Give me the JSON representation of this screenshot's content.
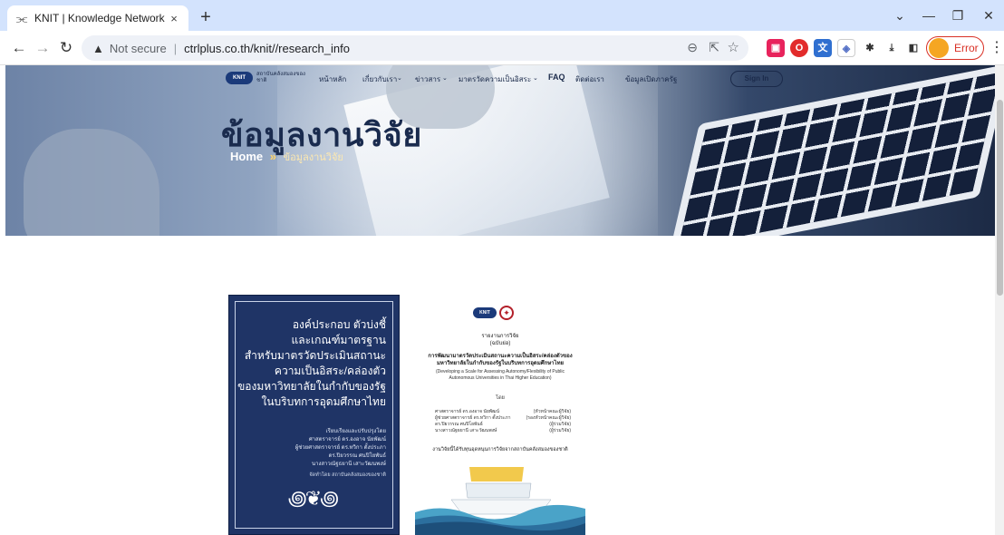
{
  "browser": {
    "tab_title": "KNIT | Knowledge Network Institu",
    "tab_close": "×",
    "new_tab": "+",
    "url_warning": "Not secure",
    "url": "ctrlplus.co.th/knit//research_info",
    "error_label": "Error",
    "minimize": "—",
    "restore": "❐",
    "close": "✕",
    "tabs_menu": "⌄"
  },
  "site": {
    "logo_badge": "KNIT",
    "logo_text": "สถาบันคลังสมองของชาติ",
    "nav": [
      {
        "label": "หน้าหลัก"
      },
      {
        "label": "เกี่ยวกับเรา"
      },
      {
        "label": "ข่าวสาร"
      },
      {
        "label": "มาตรวัดความเป็นอิสระ"
      },
      {
        "label": "FAQ"
      },
      {
        "label": "ติดต่อเรา"
      },
      {
        "label": "ข้อมูลเปิดภาครัฐ"
      }
    ],
    "signin": "Sign In",
    "hero_title": "ข้อมูลงานวิจัย",
    "breadcrumb_home": "Home",
    "breadcrumb_sep": "»",
    "breadcrumb_current": "ข้อมูลงานวิจัย"
  },
  "book": {
    "title_lines": [
      "องค์ประกอบ ตัวบ่งชี้",
      "และเกณฑ์มาตรฐาน",
      "สำหรับมาตรวัดประเมินสถานะ",
      "ความเป็นอิสระ/คล่องตัว",
      "ของมหาวิทยาลัยในกำกับของรัฐ",
      "ในบริบทการอุดมศึกษาไทย"
    ],
    "credits": [
      "เรียบเรียงและปรับปรุงโดย",
      "ศาสตราจารย์ ดร.องอาจ นัยพัฒน์",
      "ผู้ช่วยศาสตราจารย์ ดร.ทวิกา ตั้งประภา",
      "ดร.ปิยวรรณ ศนปิโยพันธ์",
      "นางสาวณัฐธยานี เสาะวัฒนพงษ์"
    ],
    "publisher": "จัดทำโดย สถาบันคลังสมองของชาติ"
  },
  "report": {
    "logo_badge": "KNIT",
    "type_lines": [
      "รายงานการวิจัย",
      "(ฉบับย่อ)"
    ],
    "title_th": "การพัฒนามาตรวัดประเมินสถานะความเป็นอิสระ/คล่องตัวของมหาวิทยาลัยในกำกับของรัฐในบริบทการอุดมศึกษาไทย",
    "title_en": "(Developing a Scale for Assessing Autonomy/Flexibility of Public Autonomous Universities in Thai Higher Education)",
    "by": "โดย",
    "authors": [
      {
        "name": "ศาสตราจารย์ ดร.องอาจ นัยพัฒน์",
        "role": "(หัวหน้าคณะผู้วิจัย)"
      },
      {
        "name": "ผู้ช่วยศาสตราจารย์ ดร.ทวิกา ตั้งประภา",
        "role": "(รองหัวหน้าคณะผู้วิจัย)"
      },
      {
        "name": "ดร.ปิยวรรณ ศนปิโยพันธ์",
        "role": "(ผู้ร่วมวิจัย)"
      },
      {
        "name": "นางสาวณัฐธยานี เสาะวัฒนพงษ์",
        "role": "(ผู้ร่วมวิจัย)"
      }
    ],
    "funding": "งานวิจัยนี้ได้รับทุนอุดหนุนการวิจัยจากสถาบันคลังสมองของชาติ"
  }
}
